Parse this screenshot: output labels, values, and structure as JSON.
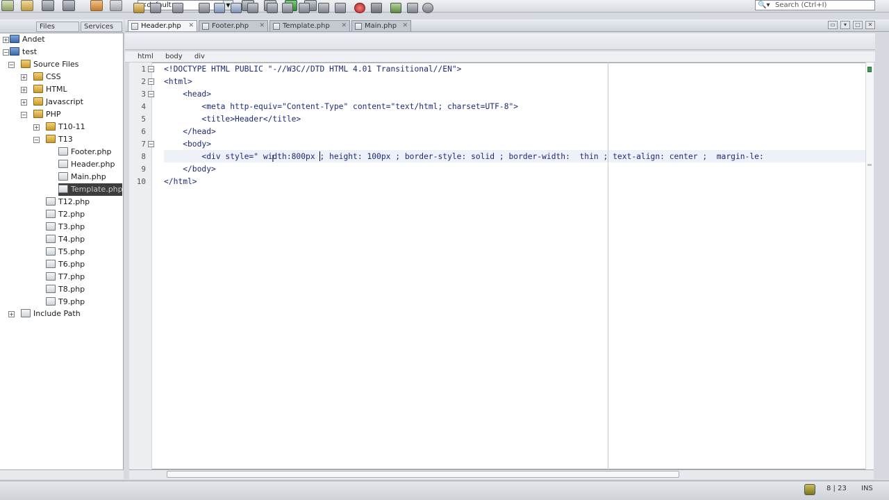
{
  "toolbar": {
    "config_value": "<default>",
    "search_placeholder": "Search (Ctrl+I)"
  },
  "left_panel": {
    "tabs": [
      "Files",
      "Services"
    ],
    "tree": [
      {
        "label": "Andet",
        "icon": "project-icon"
      },
      {
        "label": "test",
        "icon": "project-icon"
      },
      {
        "label": "Source Files",
        "icon": "folder-icon"
      },
      {
        "label": "CSS",
        "icon": "folder-icon"
      },
      {
        "label": "HTML",
        "icon": "folder-icon"
      },
      {
        "label": "Javascript",
        "icon": "folder-icon"
      },
      {
        "label": "PHP",
        "icon": "folder-icon"
      },
      {
        "label": "T10-11",
        "icon": "folder-icon"
      },
      {
        "label": "T13",
        "icon": "folder-icon"
      },
      {
        "label": "Footer.php",
        "icon": "file-icon"
      },
      {
        "label": "Header.php",
        "icon": "file-icon"
      },
      {
        "label": "Main.php",
        "icon": "file-icon"
      },
      {
        "label": "Template.php",
        "icon": "file-icon"
      },
      {
        "label": "T12.php",
        "icon": "file-icon"
      },
      {
        "label": "T2.php",
        "icon": "file-icon"
      },
      {
        "label": "T3.php",
        "icon": "file-icon"
      },
      {
        "label": "T4.php",
        "icon": "file-icon"
      },
      {
        "label": "T5.php",
        "icon": "file-icon"
      },
      {
        "label": "T6.php",
        "icon": "file-icon"
      },
      {
        "label": "T7.php",
        "icon": "file-icon"
      },
      {
        "label": "T8.php",
        "icon": "file-icon"
      },
      {
        "label": "T9.php",
        "icon": "file-icon"
      },
      {
        "label": "Include Path",
        "icon": "library-icon"
      }
    ]
  },
  "editor_tabs": [
    {
      "label": "Header.php",
      "active": true
    },
    {
      "label": "Footer.php",
      "active": false
    },
    {
      "label": "Template.php",
      "active": false
    },
    {
      "label": "Main.php",
      "active": false
    }
  ],
  "breadcrumb": [
    "html",
    "body",
    "div"
  ],
  "code": {
    "line_numbers": [
      "1",
      "2",
      "3",
      "4",
      "5",
      "6",
      "7",
      "8",
      "9",
      "10"
    ],
    "lines": [
      "<!DOCTYPE HTML PUBLIC \"-//W3C//DTD HTML 4.01 Transitional//EN\">",
      "<html>",
      "    <head>",
      "        <meta http-equiv=\"Content-Type\" content=\"text/html; charset=UTF-8\">",
      "        <title>Header</title>",
      "    </head>",
      "    <body>",
      "        <div style=\" width:800px ; height: 100px ; border-style: solid ; border-width:  thin ; text-align: center ;  margin-le:",
      "    </body>",
      "</html>"
    ]
  },
  "status": {
    "position": "8 | 23",
    "mode": "INS"
  },
  "colors": {
    "tag": "#1b2a7a",
    "gutter": "#eceef2",
    "selection": "#3d3d3d"
  }
}
